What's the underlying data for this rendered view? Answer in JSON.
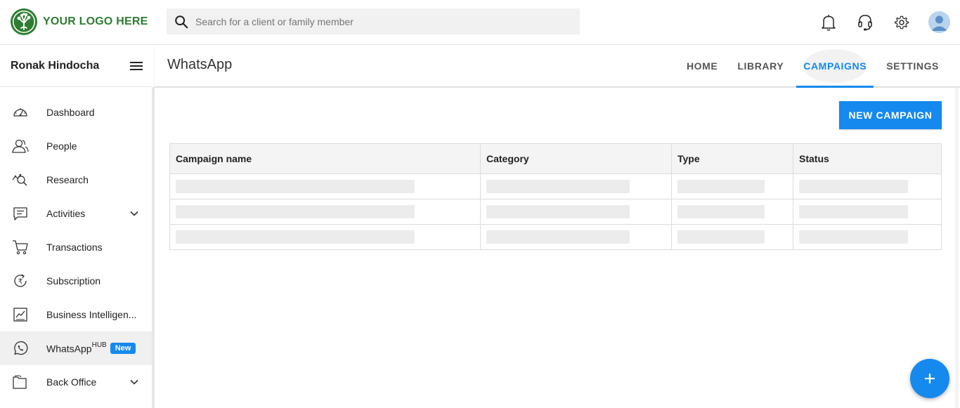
{
  "brand": {
    "logo_text": "YOUR LOGO HERE",
    "accent": "#1589ee",
    "logo_green": "#2e7d32"
  },
  "search": {
    "placeholder": "Search for a client or family member"
  },
  "top_icons": [
    "bell-icon",
    "headset-icon",
    "gear-icon",
    "avatar"
  ],
  "sidebar": {
    "user_name": "Ronak Hindocha",
    "items": [
      {
        "label": "Dashboard",
        "icon": "speedometer-icon"
      },
      {
        "label": "People",
        "icon": "people-icon"
      },
      {
        "label": "Research",
        "icon": "research-icon"
      },
      {
        "label": "Activities",
        "icon": "chat-list-icon",
        "expandable": true
      },
      {
        "label": "Transactions",
        "icon": "cart-icon"
      },
      {
        "label": "Subscription",
        "icon": "rupee-cycle-icon"
      },
      {
        "label": "Business Intelligen...",
        "icon": "chart-icon"
      },
      {
        "label": "WhatsApp",
        "sup": "HUB",
        "badge": "New",
        "icon": "whatsapp-icon",
        "active": true
      },
      {
        "label": "Back Office",
        "icon": "folder-icon",
        "expandable": true
      }
    ]
  },
  "header": {
    "title": "WhatsApp",
    "tabs": [
      {
        "label": "HOME"
      },
      {
        "label": "LIBRARY"
      },
      {
        "label": "CAMPAIGNS",
        "active": true
      },
      {
        "label": "SETTINGS"
      }
    ]
  },
  "main": {
    "new_button": "NEW CAMPAIGN",
    "table": {
      "columns": [
        "Campaign name",
        "Category",
        "Type",
        "Status"
      ],
      "loading_rows": 3
    },
    "fab_icon": "plus-icon"
  }
}
